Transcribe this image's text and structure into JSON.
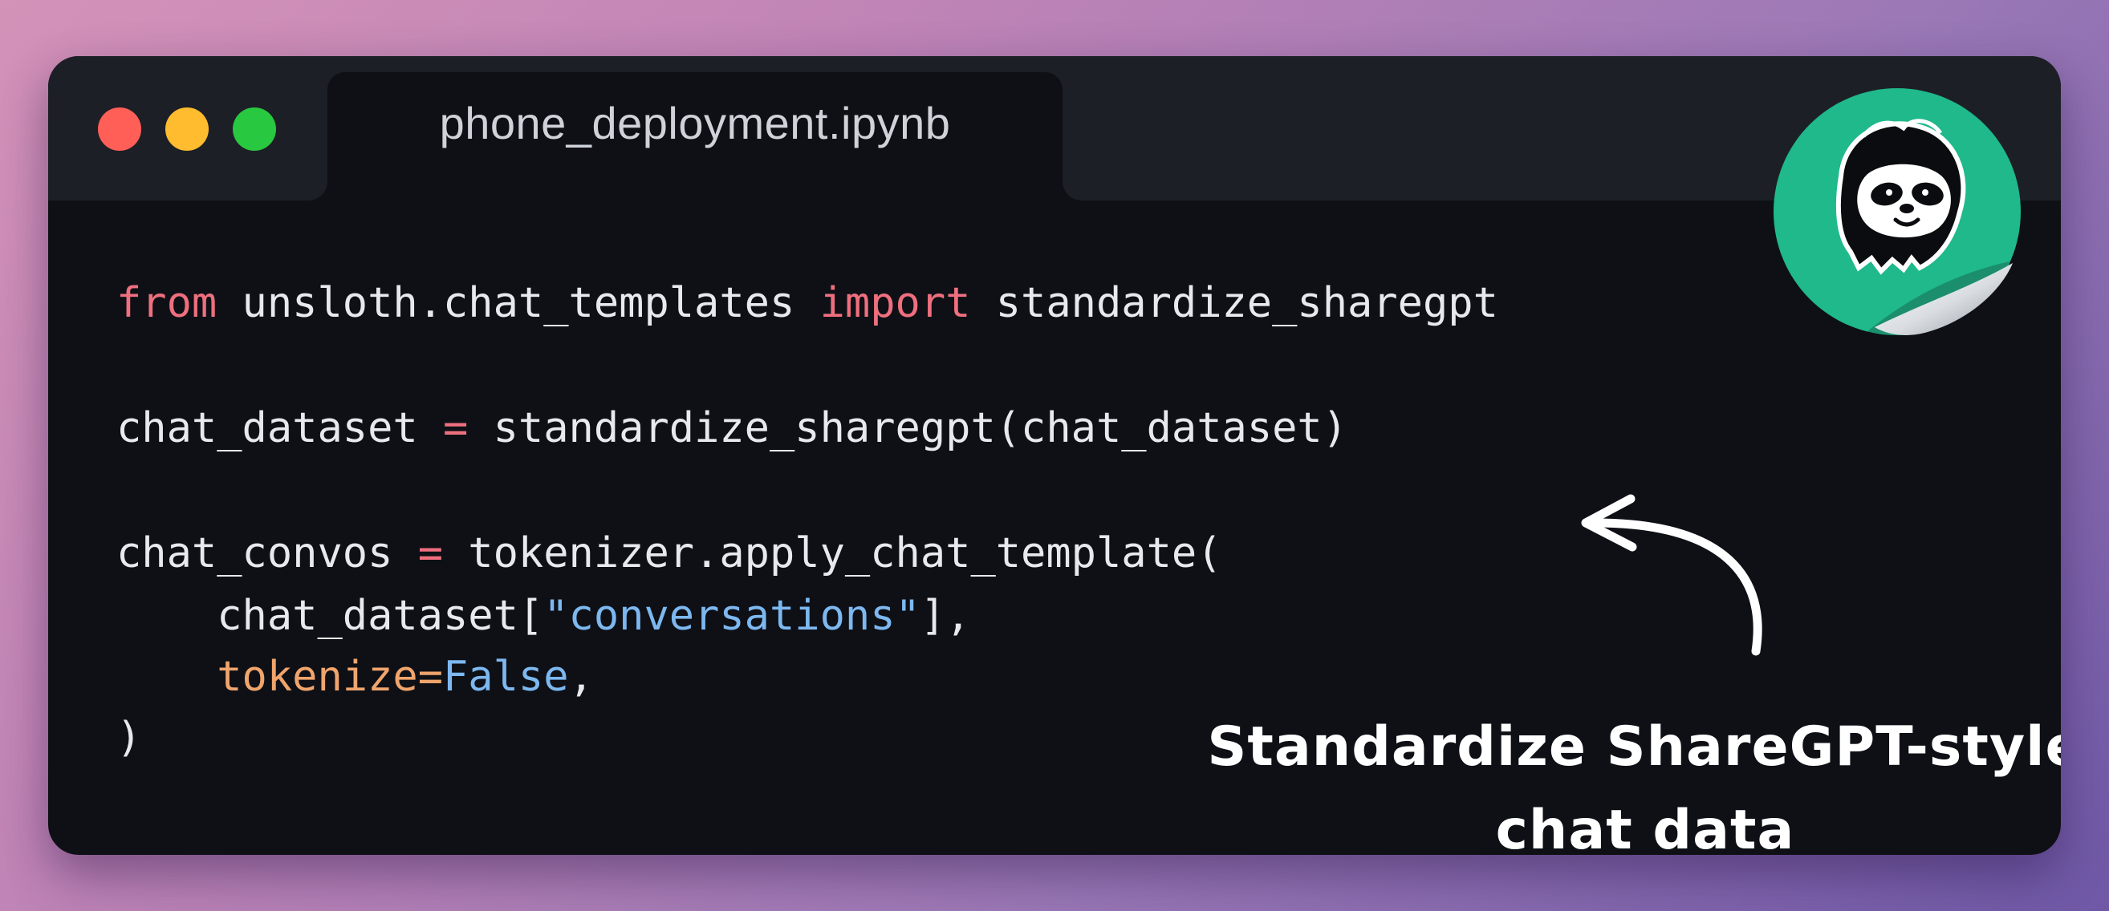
{
  "window": {
    "tab_title": "phone_deployment.ipynb"
  },
  "code": {
    "line1": {
      "kw_from": "from",
      "module": " unsloth.chat_templates ",
      "kw_import": "import",
      "name": " standardize_sharegpt"
    },
    "line2": {
      "lhs": "chat_dataset ",
      "op": "=",
      "rhs": " standardize_sharegpt(chat_dataset)"
    },
    "line3": {
      "lhs": "chat_convos ",
      "op": "=",
      "rhs": " tokenizer.apply_chat_template("
    },
    "line4": {
      "pre": "    chat_dataset[",
      "str": "\"conversations\"",
      "post": "],"
    },
    "line5": {
      "indent": "    ",
      "param": "tokenize=",
      "const": "False",
      "post": ","
    },
    "line6": {
      "text": ")"
    }
  },
  "annotation": {
    "line1": "Standardize ShareGPT-style",
    "line2": "chat data"
  },
  "colors": {
    "keyword": "#ef6f7e",
    "string": "#7db8f0",
    "param": "#f0a56c",
    "sticker_green": "#1fb98b"
  },
  "icons": {
    "close": "traffic-light-red",
    "minimize": "traffic-light-yellow",
    "maximize": "traffic-light-green",
    "logo": "sloth-sticker-icon",
    "arrow": "curved-arrow-icon"
  }
}
